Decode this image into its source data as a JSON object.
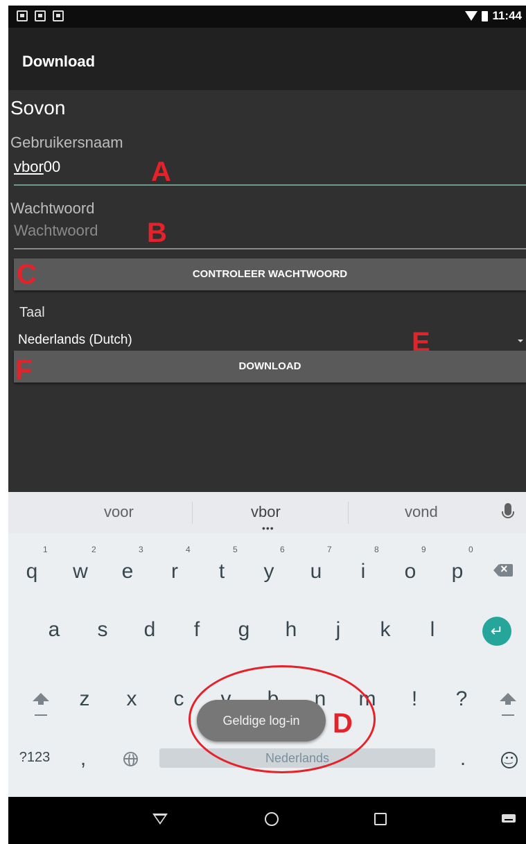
{
  "status_bar": {
    "time": "11:44"
  },
  "toolbar": {
    "title": "Download"
  },
  "form": {
    "section_title": "Sovon",
    "username_label": "Gebruikersnaam",
    "username_value_underlined": "vbor",
    "username_value_rest": "00",
    "password_label": "Wachtwoord",
    "password_placeholder": "Wachtwoord",
    "check_password_button": "CONTROLEER WACHTWOORD",
    "language_label": "Taal",
    "language_value": "Nederlands (Dutch)",
    "download_button": "DOWNLOAD"
  },
  "annotations": {
    "a": "A",
    "b": "B",
    "c": "C",
    "d": "D",
    "e": "E",
    "f": "F"
  },
  "keyboard": {
    "suggestions": [
      "voor",
      "vbor",
      "vond"
    ],
    "row1_keys": [
      "q",
      "w",
      "e",
      "r",
      "t",
      "y",
      "u",
      "i",
      "o",
      "p"
    ],
    "row1_hints": [
      "1",
      "2",
      "3",
      "4",
      "5",
      "6",
      "7",
      "8",
      "9",
      "0"
    ],
    "row2_keys": [
      "a",
      "s",
      "d",
      "f",
      "g",
      "h",
      "j",
      "k",
      "l"
    ],
    "row3_keys": [
      "z",
      "x",
      "c",
      "v",
      "b",
      "n",
      "m",
      "!",
      "?"
    ],
    "symbols_key": "?123",
    "comma_key": ",",
    "space_label": "Nederlands",
    "period_key": ".",
    "enter_glyph": "↵"
  },
  "toast": {
    "message": "Geldige log-in"
  },
  "colors": {
    "annotation_red": "#e5222a",
    "accent_teal": "#26a69a"
  }
}
